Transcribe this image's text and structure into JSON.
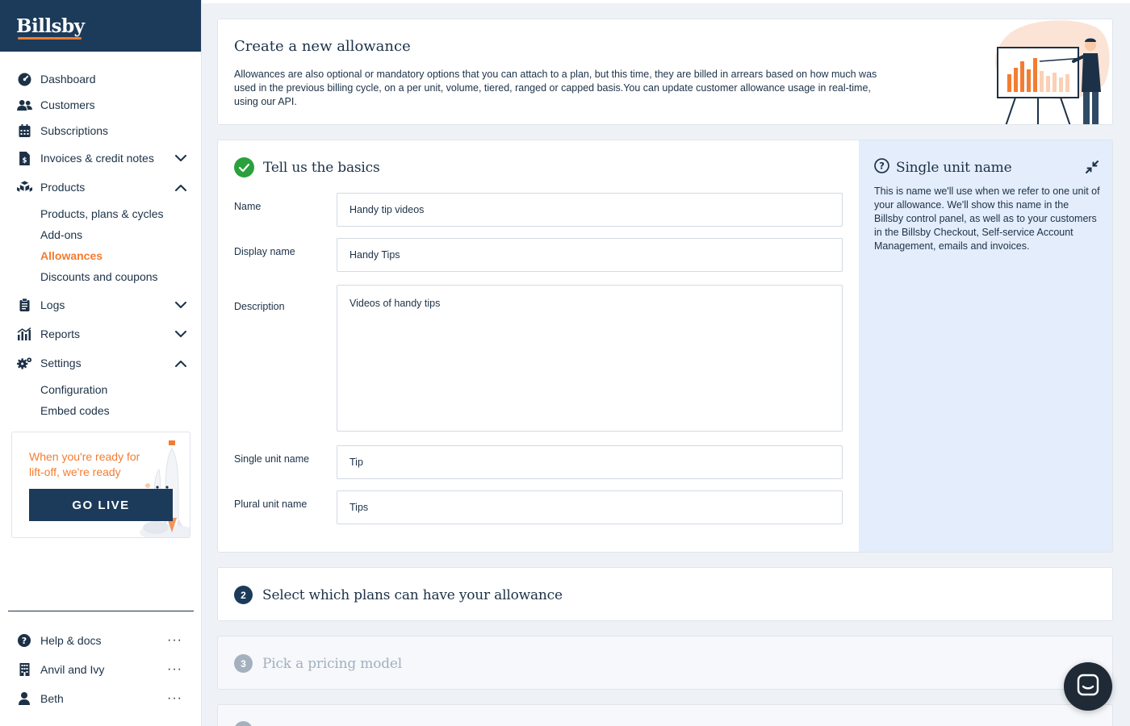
{
  "brand": {
    "name": "Billsby"
  },
  "sidebar": {
    "items": [
      {
        "label": "Dashboard"
      },
      {
        "label": "Customers"
      },
      {
        "label": "Subscriptions"
      },
      {
        "label": "Invoices & credit notes"
      },
      {
        "label": "Products"
      },
      {
        "label": "Logs"
      },
      {
        "label": "Reports"
      },
      {
        "label": "Settings"
      }
    ],
    "products_sub": [
      {
        "label": "Products, plans & cycles"
      },
      {
        "label": "Add-ons"
      },
      {
        "label": "Allowances",
        "active": true
      },
      {
        "label": "Discounts and coupons"
      }
    ],
    "settings_sub": [
      {
        "label": "Configuration"
      },
      {
        "label": "Embed codes"
      }
    ],
    "golive": {
      "text": "When you're ready for lift-off, we're ready",
      "button_label": "GO LIVE"
    },
    "bottom": [
      {
        "label": "Help & docs",
        "more": "···"
      },
      {
        "label": "Anvil and Ivy",
        "more": "···"
      },
      {
        "label": "Beth",
        "more": "···"
      }
    ]
  },
  "intro": {
    "title": "Create a new allowance",
    "description": "Allowances are also optional or mandatory options that you can attach to a plan, but this time, they are billed in arrears based on how much was used in the previous billing cycle, on a per unit, volume, tiered, ranged or capped basis.You can update customer allowance usage in real-time, using our API."
  },
  "basics": {
    "title": "Tell us the basics",
    "fields": {
      "name": {
        "label": "Name",
        "value": "Handy tip videos"
      },
      "display_name": {
        "label": "Display name",
        "value": "Handy Tips"
      },
      "description": {
        "label": "Description",
        "value": "Videos of handy tips"
      },
      "single_unit_name": {
        "label": "Single unit name",
        "value": "Tip"
      },
      "plural_unit_name": {
        "label": "Plural unit name",
        "value": "Tips"
      }
    }
  },
  "help": {
    "title": "Single unit name",
    "body": "This is name we'll use when we refer to one unit of your allowance. We'll show this name in the Billsby control panel, as well as to your customers in the Billsby Checkout, Self-service Account Management, emails and invoices."
  },
  "steps": [
    {
      "number": "2",
      "title": "Select which plans can have your allowance"
    },
    {
      "number": "3",
      "title": "Pick a pricing model"
    }
  ],
  "colors": {
    "navy": "#1c3b5a",
    "accent": "#f47c31",
    "success": "#2aa13d",
    "help_bg": "#e4edfb"
  },
  "icons": {
    "dashboard": "gauge-icon",
    "customers": "users-icon",
    "subscriptions": "calendar-icon",
    "invoices": "invoice-icon",
    "products": "boxes-icon",
    "logs": "clipboard-icon",
    "reports": "chart-icon",
    "settings": "gears-icon",
    "help": "question-circle-icon",
    "company": "building-icon",
    "user": "user-icon",
    "chat": "chat-icon"
  }
}
